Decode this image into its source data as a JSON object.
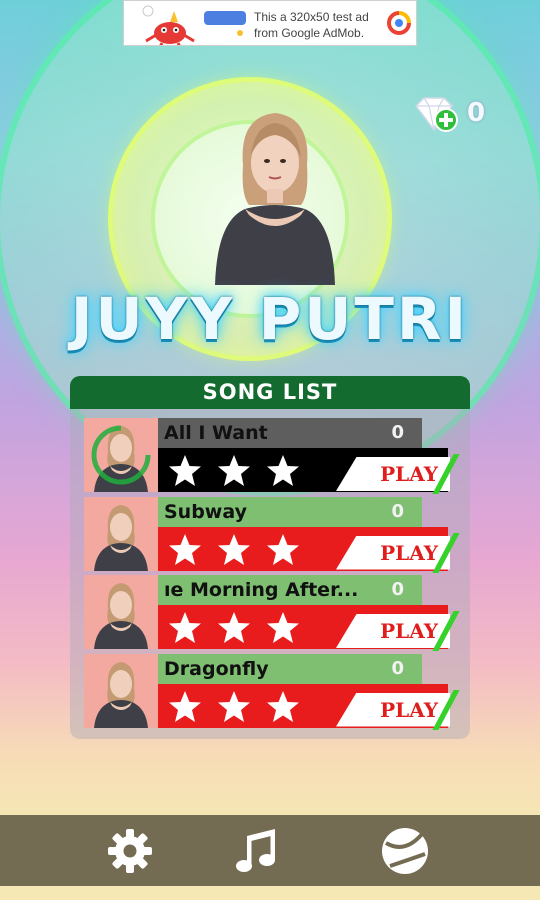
{
  "ad": {
    "text": "This a 320x50 test ad from Google AdMob."
  },
  "currency": {
    "icon": "diamond-plus-icon",
    "count": "0"
  },
  "artist": {
    "name": "JUYY PUTRI"
  },
  "song_list": {
    "title": "SONG LIST",
    "play_label": "PLAY",
    "songs": [
      {
        "title": "All I Want",
        "score": "0",
        "stars": 3,
        "locked": false,
        "title_bar_color": "#5e5e5e",
        "stars_bar_color": "#000000"
      },
      {
        "title": "Subway",
        "score": "0",
        "stars": 3,
        "locked": true,
        "title_bar_color": "#7fbf72",
        "stars_bar_color": "#e81c1c"
      },
      {
        "title": "ıe Morning After...",
        "score": "0",
        "stars": 3,
        "locked": true,
        "title_bar_color": "#7fbf72",
        "stars_bar_color": "#e81c1c"
      },
      {
        "title": "Dragonfly",
        "score": "0",
        "stars": 3,
        "locked": true,
        "title_bar_color": "#7fbf72",
        "stars_bar_color": "#e81c1c"
      }
    ]
  },
  "bottom_nav": [
    {
      "icon": "gear-icon"
    },
    {
      "icon": "music-note-icon"
    },
    {
      "icon": "ball-icon"
    }
  ],
  "colors": {
    "header_green": "#146b2f",
    "play_red": "#e01d1d",
    "accent_green": "#36d12a",
    "nav_bar": "#736b52"
  }
}
